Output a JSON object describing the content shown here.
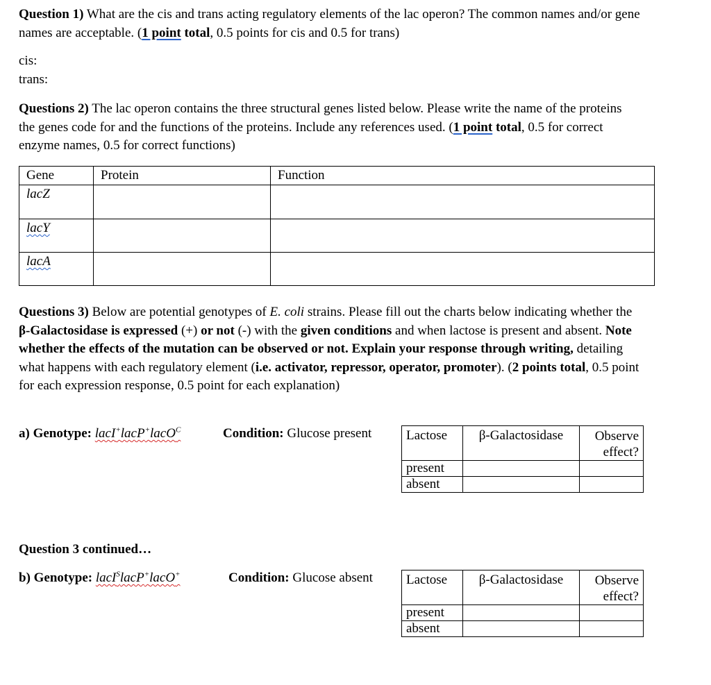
{
  "q1": {
    "label": "Question 1)",
    "text": " What are the cis and trans acting regulatory elements of the lac operon?  The common names and/or gene names are acceptable.  (",
    "points_bold_1": "1 point",
    "points_bold_2": " total",
    "points_rest": ", 0.5 points for cis and 0.5 for trans)",
    "cis_label": "cis:",
    "trans_label": "trans:"
  },
  "q2": {
    "label": "Questions 2)",
    "text": " The lac operon contains the three structural genes listed below.  Please write the name of the proteins the genes code for and the functions of the proteins.  Include any references used.  (",
    "points_bold_1": "1 point",
    "points_bold_2": " total",
    "points_rest": ", 0.5 for correct enzyme names, 0.5 for correct functions)",
    "table": {
      "headers": [
        "Gene",
        "Protein",
        "Function"
      ],
      "rows": [
        {
          "gene": "lacZ",
          "protein": "",
          "function": ""
        },
        {
          "gene": "lacY",
          "protein": "",
          "function": ""
        },
        {
          "gene": "lacA",
          "protein": "",
          "function": ""
        }
      ]
    }
  },
  "q3": {
    "label": "Questions 3)",
    "t1": " Below are potential genotypes of ",
    "ecoli": "E. coli",
    "t2": " strains.  Please fill out the charts below indicating whether the ",
    "b1": "β-Galactosidase is expressed",
    "t3": " (+) ",
    "b2": "or not",
    "t4": " (-) with the ",
    "b3": "given conditions",
    "t5": " and when lactose is present and absent.  ",
    "b4": "Note whether the effects of the mutation can be observed or not.  Explain your response through writing,",
    "t6": " detailing what happens with each regulatory element (",
    "b5": "i.e. activator, repressor, operator, promoter",
    "t7": ").  (",
    "b6": "2 points total",
    "t8": ", 0.5 point for each expression response, 0.5 point for each explanation)",
    "continued": "Question 3 continued…",
    "parts": [
      {
        "label": "a) Genotype:",
        "genotype": [
          {
            "base": "lacI",
            "sup": "+"
          },
          {
            "base": "lacP",
            "sup": "+"
          },
          {
            "base": "lacO",
            "sup": "C"
          }
        ],
        "condition_label": "Condition:",
        "condition": "Glucose present",
        "headers": [
          "Lactose",
          "β-Galactosidase",
          "Observe effect?"
        ],
        "rows": [
          {
            "lactose": "present",
            "bgal": "",
            "observe": ""
          },
          {
            "lactose": "absent",
            "bgal": "",
            "observe": ""
          }
        ]
      },
      {
        "label": "b) Genotype:",
        "genotype": [
          {
            "base": "lacI",
            "sup": "S"
          },
          {
            "base": "lacP",
            "sup": "+"
          },
          {
            "base": "lacO",
            "sup": "+"
          }
        ],
        "condition_label": "Condition:",
        "condition": "Glucose absent",
        "headers": [
          "Lactose",
          "β-Galactosidase",
          "Observe effect?"
        ],
        "rows": [
          {
            "lactose": "present",
            "bgal": "",
            "observe": ""
          },
          {
            "lactose": "absent",
            "bgal": "",
            "observe": ""
          }
        ]
      }
    ]
  }
}
